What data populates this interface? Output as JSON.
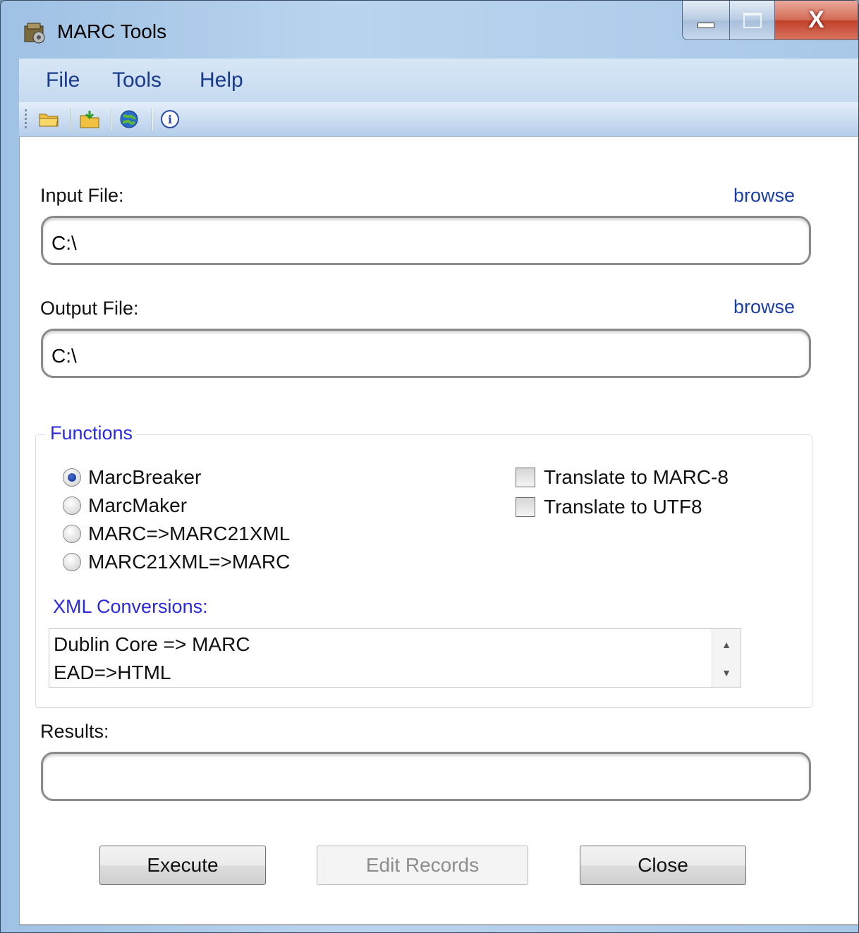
{
  "window": {
    "title": "MARC Tools",
    "close_glyph": "X"
  },
  "menu": {
    "items": [
      "File",
      "Tools",
      "Help"
    ]
  },
  "toolbar": {
    "icons": [
      "open-folder-icon",
      "save-folder-icon",
      "globe-icon",
      "info-icon"
    ]
  },
  "input_file": {
    "label": "Input File:",
    "browse": "browse",
    "value": "C:\\"
  },
  "output_file": {
    "label": "Output File:",
    "browse": "browse",
    "value": "C:\\"
  },
  "functions": {
    "legend": "Functions",
    "radios": [
      {
        "label": "MarcBreaker",
        "checked": true
      },
      {
        "label": "MarcMaker",
        "checked": false
      },
      {
        "label": "MARC=>MARC21XML",
        "checked": false
      },
      {
        "label": "MARC21XML=>MARC",
        "checked": false
      }
    ],
    "checkboxes": [
      {
        "label": "Translate to MARC-8",
        "checked": false
      },
      {
        "label": "Translate to UTF8",
        "checked": false
      }
    ],
    "xml_label": "XML Conversions:",
    "xml_items": [
      "Dublin Core => MARC",
      "EAD=>HTML"
    ]
  },
  "results": {
    "label": "Results:",
    "value": ""
  },
  "buttons": {
    "execute": "Execute",
    "edit_records": "Edit Records",
    "close": "Close"
  },
  "colors": {
    "link": "#1b3fa6",
    "group_label": "#2a2ae0",
    "menu_text": "#1a3a8c"
  }
}
